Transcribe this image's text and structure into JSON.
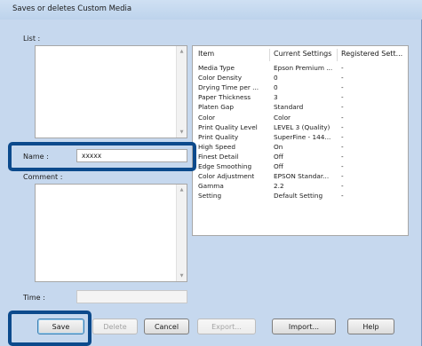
{
  "window": {
    "title": "Saves or deletes Custom Media"
  },
  "list": {
    "label": "List :"
  },
  "name": {
    "label": "Name :",
    "value": "xxxxx"
  },
  "comment": {
    "label": "Comment :"
  },
  "time": {
    "label": "Time :"
  },
  "table": {
    "columns": [
      "Item",
      "Current Settings",
      "Registered Sett..."
    ],
    "rows": [
      [
        "Media Type",
        "Epson Premium ...",
        "-"
      ],
      [
        "Color Density",
        "0",
        "-"
      ],
      [
        "Drying Time per ...",
        "0",
        "-"
      ],
      [
        "Paper Thickness",
        "3",
        "-"
      ],
      [
        "Platen Gap",
        "Standard",
        "-"
      ],
      [
        "Color",
        "Color",
        "-"
      ],
      [
        "Print Quality Level",
        "LEVEL 3 (Quality)",
        "-"
      ],
      [
        "Print Quality",
        "SuperFine - 144...",
        "-"
      ],
      [
        "High Speed",
        "On",
        "-"
      ],
      [
        "Finest Detail",
        "Off",
        "-"
      ],
      [
        "Edge Smoothing",
        "Off",
        "-"
      ],
      [
        "Color Adjustment",
        "EPSON Standar...",
        "-"
      ],
      [
        "Gamma",
        "2.2",
        "-"
      ],
      [
        "Setting",
        "Default Setting",
        "-"
      ]
    ]
  },
  "buttons": {
    "save": "Save",
    "delete": "Delete",
    "cancel": "Cancel",
    "export": "Export...",
    "import": "Import...",
    "help": "Help"
  },
  "colors": {
    "highlight": "#0c4a8c",
    "titlebar": "#c6d8ee",
    "panel": "#f0f0f0"
  }
}
